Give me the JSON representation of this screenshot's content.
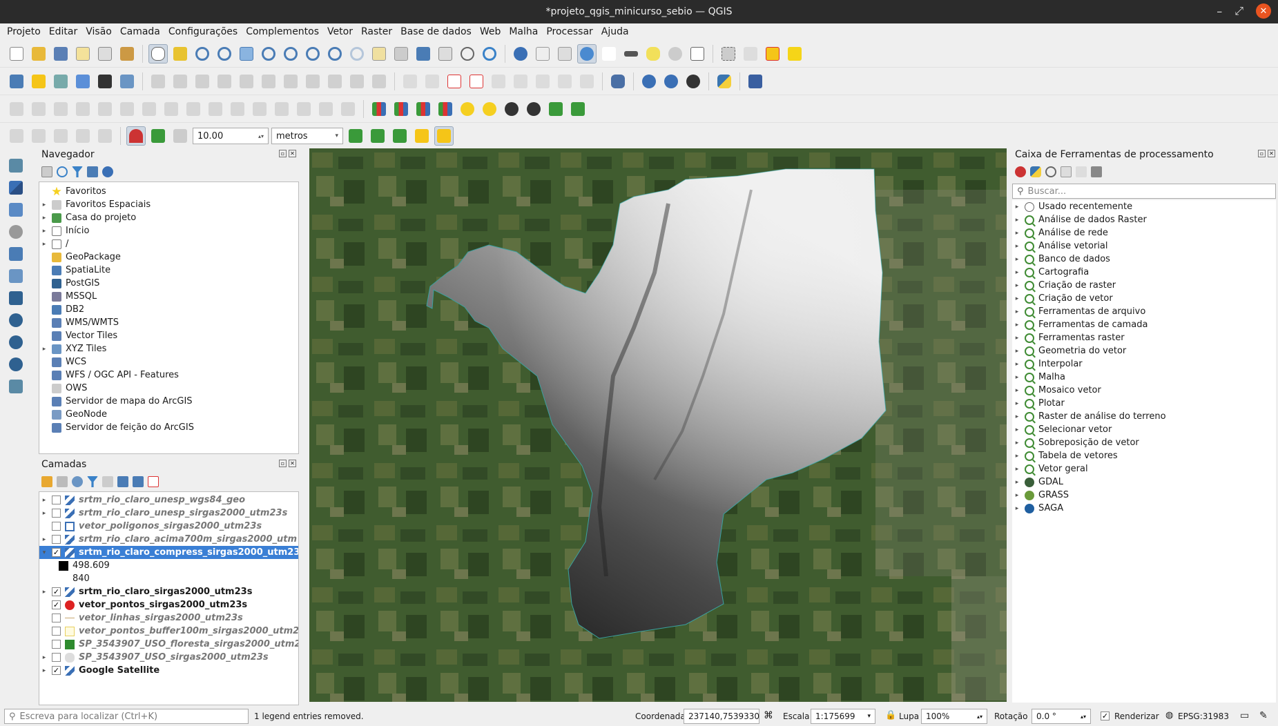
{
  "window": {
    "title": "*projeto_qgis_minicurso_sebio — QGIS",
    "close_glyph": "✕",
    "min_glyph": "–",
    "max_glyph": "⤢"
  },
  "menu": [
    "Projeto",
    "Editar",
    "Visão",
    "Camada",
    "Configurações",
    "Complementos",
    "Vetor",
    "Raster",
    "Base de dados",
    "Web",
    "Malha",
    "Processar",
    "Ajuda"
  ],
  "snapping": {
    "tolerance": "10.00",
    "units": "metros"
  },
  "navigator": {
    "title": "Navegador",
    "items": [
      {
        "label": "Favoritos",
        "icon": "star-icon",
        "expand": false
      },
      {
        "label": "Favoritos Espaciais",
        "icon": "spatial-bookmark-icon",
        "expand": true
      },
      {
        "label": "Casa do projeto",
        "icon": "project-home-icon",
        "expand": true
      },
      {
        "label": "Início",
        "icon": "folder-icon",
        "expand": true
      },
      {
        "label": "/",
        "icon": "folder-icon",
        "expand": true
      },
      {
        "label": "GeoPackage",
        "icon": "geopackage-icon",
        "expand": false
      },
      {
        "label": "SpatiaLite",
        "icon": "spatialite-icon",
        "expand": false
      },
      {
        "label": "PostGIS",
        "icon": "postgis-icon",
        "expand": false
      },
      {
        "label": "MSSQL",
        "icon": "mssql-icon",
        "expand": false
      },
      {
        "label": "DB2",
        "icon": "db2-icon",
        "expand": false
      },
      {
        "label": "WMS/WMTS",
        "icon": "wms-icon",
        "expand": false
      },
      {
        "label": "Vector Tiles",
        "icon": "vector-tiles-icon",
        "expand": false
      },
      {
        "label": "XYZ Tiles",
        "icon": "xyz-tiles-icon",
        "expand": true
      },
      {
        "label": "WCS",
        "icon": "wcs-icon",
        "expand": false
      },
      {
        "label": "WFS / OGC API - Features",
        "icon": "wfs-icon",
        "expand": false
      },
      {
        "label": "OWS",
        "icon": "ows-icon",
        "expand": false
      },
      {
        "label": "Servidor de mapa do ArcGIS",
        "icon": "arcgis-map-icon",
        "expand": false
      },
      {
        "label": "GeoNode",
        "icon": "geonode-icon",
        "expand": false
      },
      {
        "label": "Servidor de feição do ArcGIS",
        "icon": "arcgis-feature-icon",
        "expand": false
      }
    ]
  },
  "layers": {
    "title": "Camadas",
    "items": [
      {
        "label": "srtm_rio_claro_unesp_wgs84_geo",
        "style": "it",
        "checked": false,
        "icon": "raster",
        "expand": "▸"
      },
      {
        "label": "srtm_rio_claro_unesp_sirgas2000_utm23s",
        "style": "it",
        "checked": false,
        "icon": "raster",
        "expand": "▸"
      },
      {
        "label": "vetor_poligonos_sirgas2000_utm23s",
        "style": "it",
        "checked": false,
        "icon": "polygon-empty",
        "expand": ""
      },
      {
        "label": "srtm_rio_claro_acima700m_sirgas2000_utm",
        "style": "it",
        "checked": false,
        "icon": "raster",
        "expand": "▸"
      },
      {
        "label": "srtm_rio_claro_compress_sirgas2000_utm23",
        "style": "sel",
        "checked": true,
        "icon": "raster",
        "expand": "▾"
      },
      {
        "label": "498.609",
        "style": "legend",
        "checked": null,
        "icon": "black",
        "expand": ""
      },
      {
        "label": "840",
        "style": "legend",
        "checked": null,
        "icon": "white",
        "expand": ""
      },
      {
        "label": "srtm_rio_claro_sirgas2000_utm23s",
        "style": "bold",
        "checked": true,
        "icon": "raster",
        "expand": "▸"
      },
      {
        "label": "vetor_pontos_sirgas2000_utm23s",
        "style": "bold",
        "checked": true,
        "icon": "red-point",
        "expand": ""
      },
      {
        "label": "vetor_linhas_sirgas2000_utm23s",
        "style": "it",
        "checked": false,
        "icon": "line",
        "expand": ""
      },
      {
        "label": "vetor_pontos_buffer100m_sirgas2000_utm2",
        "style": "it",
        "checked": false,
        "icon": "yellow-poly",
        "expand": ""
      },
      {
        "label": "SP_3543907_USO_floresta_sirgas2000_utm2",
        "style": "it",
        "checked": false,
        "icon": "green-poly",
        "expand": ""
      },
      {
        "label": "SP_3543907_USO_sirgas2000_utm23s",
        "style": "it",
        "checked": false,
        "icon": "group",
        "expand": "▸"
      },
      {
        "label": "Google Satellite",
        "style": "bold",
        "checked": true,
        "icon": "raster",
        "expand": "▸"
      }
    ]
  },
  "toolbox": {
    "title": "Caixa de Ferramentas de processamento",
    "search_placeholder": "Buscar...",
    "items": [
      {
        "label": "Usado recentemente",
        "icon": "clock-icon"
      },
      {
        "label": "Análise de dados Raster",
        "icon": "qgis-icon"
      },
      {
        "label": "Análise de rede",
        "icon": "qgis-icon"
      },
      {
        "label": "Análise vetorial",
        "icon": "qgis-icon"
      },
      {
        "label": "Banco de dados",
        "icon": "qgis-icon"
      },
      {
        "label": "Cartografia",
        "icon": "qgis-icon"
      },
      {
        "label": "Criação de raster",
        "icon": "qgis-icon"
      },
      {
        "label": "Criação de vetor",
        "icon": "qgis-icon"
      },
      {
        "label": "Ferramentas de arquivo",
        "icon": "qgis-icon"
      },
      {
        "label": "Ferramentas de camada",
        "icon": "qgis-icon"
      },
      {
        "label": "Ferramentas raster",
        "icon": "qgis-icon"
      },
      {
        "label": "Geometria do vetor",
        "icon": "qgis-icon"
      },
      {
        "label": "Interpolar",
        "icon": "qgis-icon"
      },
      {
        "label": "Malha",
        "icon": "qgis-icon"
      },
      {
        "label": "Mosaico vetor",
        "icon": "qgis-icon"
      },
      {
        "label": "Plotar",
        "icon": "qgis-icon"
      },
      {
        "label": "Raster de análise do terreno",
        "icon": "qgis-icon"
      },
      {
        "label": "Selecionar vetor",
        "icon": "qgis-icon"
      },
      {
        "label": "Sobreposição de vetor",
        "icon": "qgis-icon"
      },
      {
        "label": "Tabela de vetores",
        "icon": "qgis-icon"
      },
      {
        "label": "Vetor geral",
        "icon": "qgis-icon"
      },
      {
        "label": "GDAL",
        "icon": "gdal-icon"
      },
      {
        "label": "GRASS",
        "icon": "grass-icon"
      },
      {
        "label": "SAGA",
        "icon": "saga-icon"
      }
    ]
  },
  "status": {
    "locator_placeholder": "Escreva para localizar (Ctrl+K)",
    "message": "1 legend entries removed.",
    "coord_label": "Coordenada",
    "coord_value": "237140,7539330",
    "scale_label": "Escala",
    "scale_value": "1:175699",
    "magnifier_label": "Lupa",
    "magnifier_value": "100%",
    "rotation_label": "Rotação",
    "rotation_value": "0.0 °",
    "render_label": "Renderizar",
    "crs": "EPSG:31983"
  },
  "colors": {
    "accent": "#3a7fd5",
    "dem_low": "#111111",
    "dem_high": "#f0f0f0",
    "satellite": "#3d5a2e"
  }
}
